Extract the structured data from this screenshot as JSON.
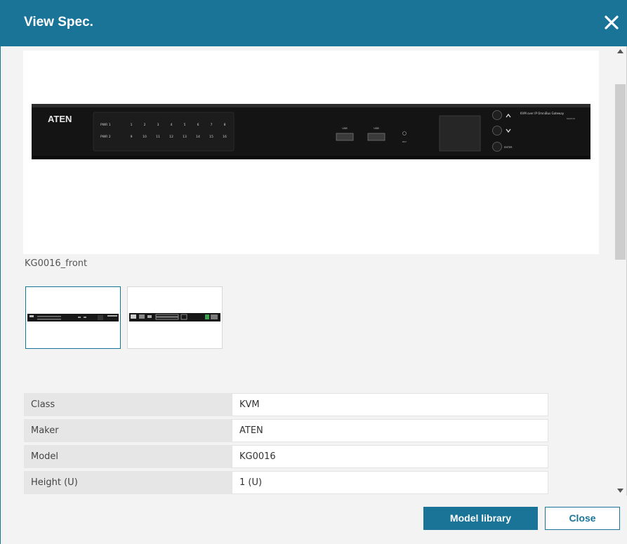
{
  "dialog": {
    "title": "View Spec.",
    "close_icon": "close-icon"
  },
  "image": {
    "caption": "KG0016_front",
    "device_brand": "ATEN",
    "device_panel": {
      "pwr1_label": "PWR 1",
      "pwr2_label": "PWR 2",
      "ports_row1": [
        "1",
        "2",
        "3",
        "4",
        "5",
        "6",
        "7",
        "8"
      ],
      "ports_row2": [
        "9",
        "10",
        "11",
        "12",
        "13",
        "14",
        "15",
        "16"
      ],
      "usb_label": "USB",
      "reset_label": "RST",
      "enter_label": "ENTER",
      "product_name": "KVM over IP OmniBus Gateway",
      "product_model": "KG0016"
    }
  },
  "thumbnails": [
    {
      "name": "front",
      "selected": true
    },
    {
      "name": "rear",
      "selected": false
    }
  ],
  "specs": [
    {
      "label": "Class",
      "value": "KVM"
    },
    {
      "label": "Maker",
      "value": "ATEN"
    },
    {
      "label": "Model",
      "value": "KG0016"
    },
    {
      "label": "Height (U)",
      "value": "1 (U)"
    }
  ],
  "footer": {
    "model_library_label": "Model library",
    "close_label": "Close"
  },
  "colors": {
    "accent": "#1a7497",
    "background": "#f3f3f3"
  }
}
